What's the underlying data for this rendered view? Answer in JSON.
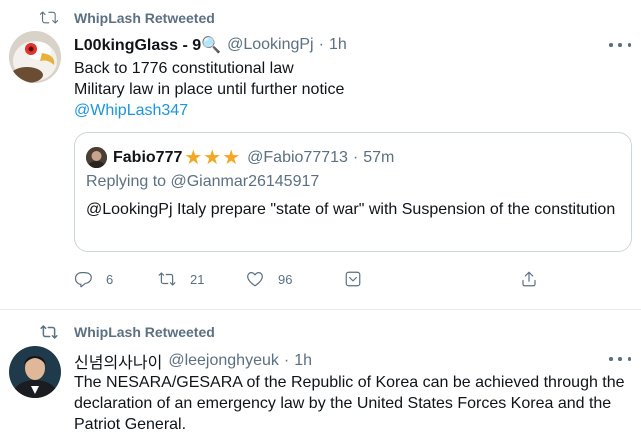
{
  "tweets": [
    {
      "retweeted_by": "WhipLash Retweeted",
      "display_name": "L00kingGlass - 9🔍",
      "handle": "@LookingPj",
      "time": "1h",
      "lines": [
        "Back to 1776 constitutional law",
        "Military law in place until further notice"
      ],
      "mention": "@WhipLash347",
      "quoted": {
        "display_name": "Fabio777",
        "badges": "★★★",
        "handle": "@Fabio77713",
        "time": "57m",
        "replying_to": "Replying to @Gianmar26145917",
        "text": "@LookingPj Italy prepare \"state of war\" with Suspension of the constitution"
      },
      "actions": {
        "replies": "6",
        "retweets": "21",
        "likes": "96"
      }
    },
    {
      "retweeted_by": "WhipLash Retweeted",
      "display_name": "신념의사나이",
      "handle": "@leejonghyeuk",
      "time": "1h",
      "text": "The NESARA/GESARA of the Republic of Korea can be achieved through the declaration of an emergency law by the United States Forces Korea and the Patriot General."
    }
  ],
  "icons": {
    "retweet": "retweet-icon",
    "reply": "reply-icon",
    "like": "heart-icon",
    "save": "save-icon",
    "share": "share-icon",
    "more": "more-icon"
  },
  "colors": {
    "muted": "#5b7083",
    "link": "#1b95e0",
    "star": "#f5a623",
    "border": "#ccd6dd"
  }
}
